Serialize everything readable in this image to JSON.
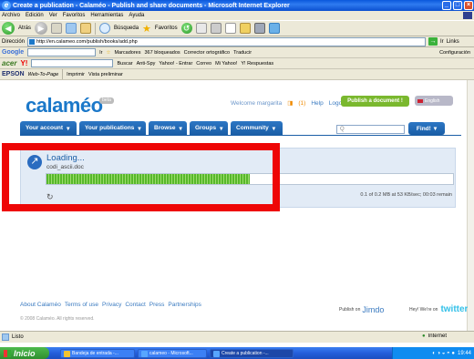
{
  "window": {
    "title": "Create a publication - Calaméo - Publish and share documents - Microsoft Internet Explorer",
    "minimize": "_",
    "maximize": "□",
    "close": "×"
  },
  "menu": [
    "Archivo",
    "Edición",
    "Ver",
    "Favoritos",
    "Herramientas",
    "Ayuda"
  ],
  "nav": {
    "back": "Atrás",
    "search": "Búsqueda",
    "favorites": "Favoritos"
  },
  "address": {
    "label": "Dirección",
    "url": "http://en.calameo.com/publish/books/add.php",
    "go": "Ir",
    "links": "Links"
  },
  "google_bar": {
    "brand": "Google",
    "go": "Ir",
    "bookmarks": "Marcadores",
    "blocked": "367 bloqueados",
    "spell": "Corrector ortográfico",
    "translate": "Traducir",
    "settings": "Configuración"
  },
  "yahoo_bar": {
    "brand": "acer",
    "yahoo": "Y!",
    "search": "Buscar",
    "antispy": "Anti-Spy",
    "signin": "Yahoo! - Entrar",
    "mail": "Correo",
    "my_yahoo": "Mi Yahoo!",
    "answers": "Y! Respuestas"
  },
  "epson_bar": {
    "brand": "EPSON",
    "web_to_page": "Web-To-Page",
    "print": "Imprimir",
    "preview": "Vista preliminar"
  },
  "site": {
    "logo": "calaméo",
    "beta": "beta",
    "welcome": "Welcome margarita",
    "rss": "(1)",
    "help": "Help",
    "logout": "Logout",
    "publish_button": "Publish a document !",
    "language": "English",
    "tabs": [
      "Your account",
      "Your publications",
      "Browse",
      "Groups",
      "Community"
    ],
    "search_placeholder": "Q",
    "find": "Find!"
  },
  "upload": {
    "title": "Loading...",
    "filename": "codi_ascii.doc",
    "progress": 0.5,
    "status": "0.1 of 0.2 MB at 53 KB/sec; 00:03 remain"
  },
  "footer": {
    "links": [
      "About Calaméo",
      "Terms of use",
      "Privacy",
      "Contact",
      "Press",
      "Partnerships"
    ],
    "copyright": "© 2008 Calaméo. All rights reserved.",
    "publish_on": "Publish on",
    "issuu": "Jimdo",
    "hey": "Hey! We're on",
    "twitter": "twitter"
  },
  "status": {
    "text": "Listo",
    "zone": "Internet"
  },
  "taskbar": {
    "start": "Inicio",
    "tasks": [
      "Bandeja de entrada -...",
      "calameo - Microsoft...",
      "Create a publication -..."
    ],
    "clock": "19:44"
  },
  "colors": {
    "accent": "#1b78c9",
    "highlight": "#ee0606",
    "progress": "#57b82a"
  }
}
